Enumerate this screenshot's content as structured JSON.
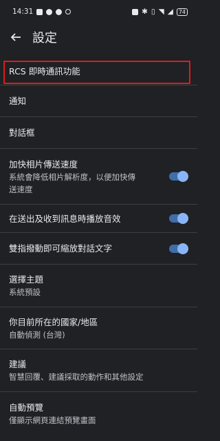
{
  "status_bar": {
    "time": "14:31",
    "battery": "74"
  },
  "header": {
    "title": "設定"
  },
  "settings": [
    {
      "title": "RCS 即時通訊功能",
      "subtitle": ""
    },
    {
      "title": "通知",
      "subtitle": ""
    },
    {
      "title": "對話框",
      "subtitle": ""
    },
    {
      "title": "加快相片傳送速度",
      "subtitle_lines": [
        "系統會降低相片解析度，以便加快傳",
        "送速度"
      ],
      "toggle": true
    },
    {
      "title": "在送出及收到訊息時播放音效",
      "toggle": true
    },
    {
      "title": "雙指撥動即可縮放對話文字",
      "toggle": true
    },
    {
      "title": "選擇主題",
      "subtitle": "系統預設"
    },
    {
      "title": "你目前所在的國家/地區",
      "subtitle": "自動偵測 (台灣)"
    },
    {
      "title": "建議",
      "subtitle": "智慧回覆、建議採取的動作和其他設定"
    },
    {
      "title": "自動預覽",
      "subtitle": "僅顯示網頁連結預覽畫面"
    }
  ],
  "colors": {
    "background": "#202124",
    "toggle_on": "#8ab4f8",
    "highlight": "#e01b1b"
  }
}
